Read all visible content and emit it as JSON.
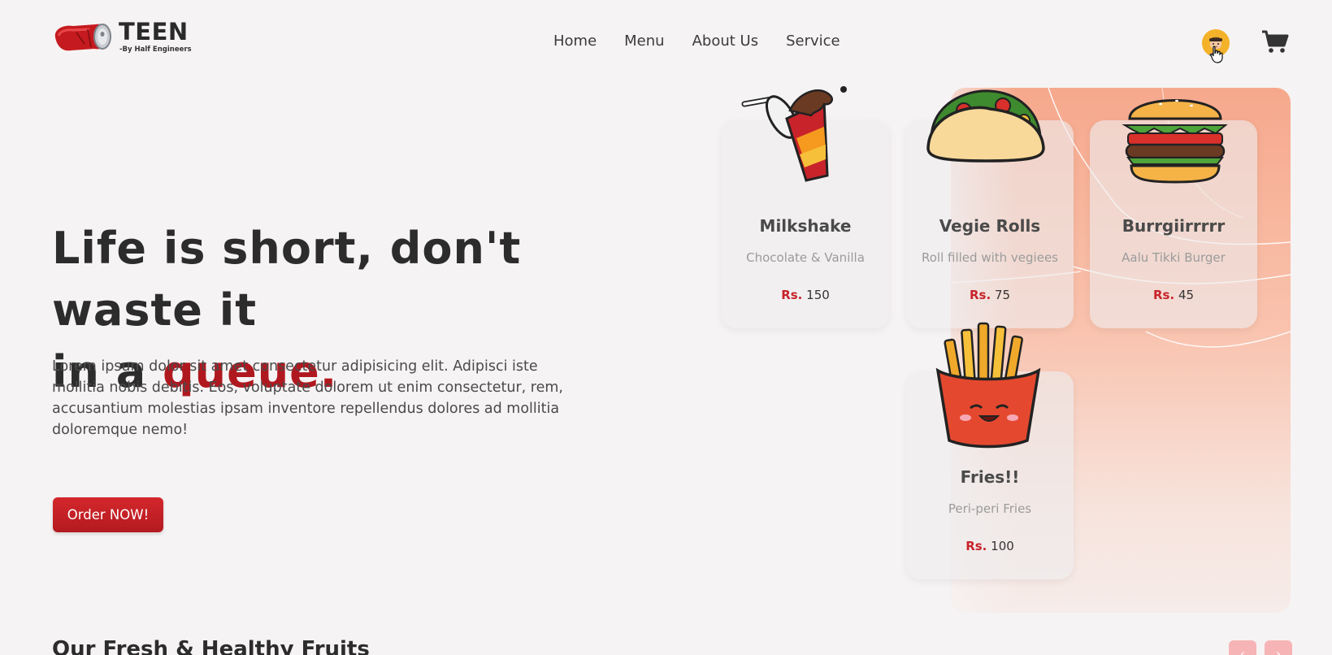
{
  "brand": {
    "title": "TEEN",
    "subtitle": "-By Half Engineers"
  },
  "nav": {
    "items": [
      "Home",
      "Menu",
      "About Us",
      "Service"
    ]
  },
  "hero": {
    "title_line1": "Life is short, don't waste it",
    "title_line2_prefix": "in a ",
    "title_accent": "queue.",
    "description": "Lorem ipsum dolor sit amet consectetur adipisicing elit. Adipisci iste mollitia nobis debitis. Eos, voluptate dolorem ut enim consectetur, rem, accusantium molestias ipsam inventore repellendus dolores ad mollitia doloremque nemo!",
    "cta": "Order NOW!"
  },
  "cards": [
    {
      "name": "Milkshake",
      "desc": "Chocolate & Vanilla",
      "currency": "Rs.",
      "price": "150",
      "icon": "milkshake-icon"
    },
    {
      "name": "Vegie Rolls",
      "desc": "Roll filled with vegiees",
      "currency": "Rs.",
      "price": "75",
      "icon": "taco-icon"
    },
    {
      "name": "Burrgiirrrrr",
      "desc": "Aalu Tikki Burger",
      "currency": "Rs.",
      "price": "45",
      "icon": "burger-icon"
    },
    {
      "name": "Fries!!",
      "desc": "Peri-peri Fries",
      "currency": "Rs.",
      "price": "100",
      "icon": "fries-icon"
    }
  ],
  "section": {
    "title": "Our Fresh & Healthy Fruits"
  },
  "colors": {
    "accent": "#b0181f",
    "button": "#c9232a",
    "panel": "#f6a88c",
    "avatar": "#f3b229"
  }
}
